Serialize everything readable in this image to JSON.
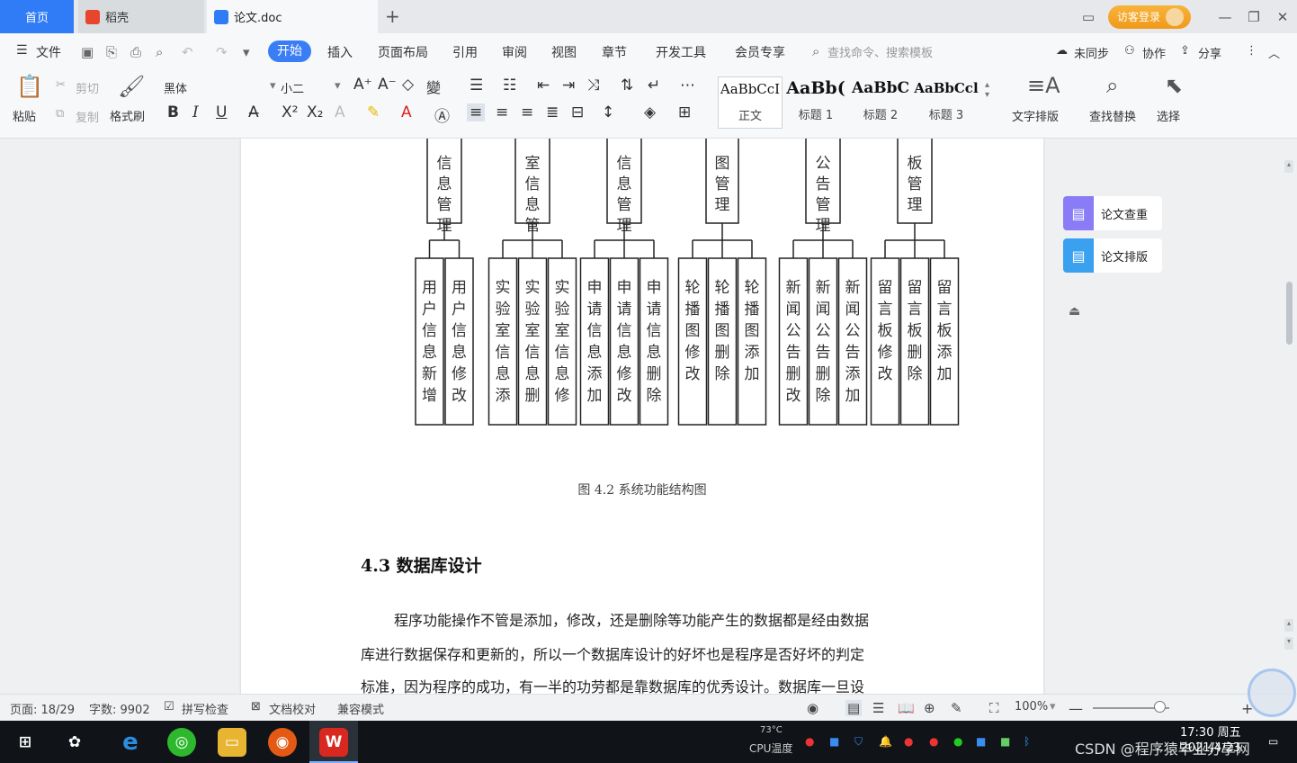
{
  "titlebar": {
    "tab_home": "首页",
    "tab_wps": "稻壳",
    "tab_doc": "论文.doc",
    "login": "访客登录"
  },
  "menu": {
    "file": "文件",
    "items": [
      "开始",
      "插入",
      "页面布局",
      "引用",
      "审阅",
      "视图",
      "章节",
      "开发工具",
      "会员专享"
    ],
    "search": "查找命令、搜索模板",
    "sync": "未同步",
    "collab": "协作",
    "share": "分享"
  },
  "ribbon": {
    "paste": "粘贴",
    "cut": "剪切",
    "copy": "复制",
    "format_painter": "格式刷",
    "font_name": "黑体",
    "font_size": "小二",
    "styles": [
      {
        "sample": "AaBbCcI",
        "name": "正文"
      },
      {
        "sample": "AaBb(",
        "name": "标题 1"
      },
      {
        "sample": "AaBbC",
        "name": "标题 2"
      },
      {
        "sample": "AaBbCcl",
        "name": "标题 3"
      }
    ],
    "text_layout": "文字排版",
    "find_replace": "查找替换",
    "select": "选择"
  },
  "diagram": {
    "top_boxes": [
      "信息管理",
      "室信息管",
      "信息管理",
      "图管理",
      "公告管理",
      "板管理"
    ],
    "leaves": [
      [
        "用户信息新增",
        "用户信息修改"
      ],
      [
        "实验室信息添",
        "实验室信息删",
        "实验室信息修"
      ],
      [
        "申请信息添加",
        "申请信息修改",
        "申请信息删除"
      ],
      [
        "轮播图修改",
        "轮播图删除",
        "轮播图添加"
      ],
      [
        "新闻公告删改",
        "新闻公告删除",
        "新闻公告添加"
      ],
      [
        "留言板修改",
        "留言板删除",
        "留言板添加"
      ]
    ]
  },
  "document": {
    "caption": "图 4.2  系统功能结构图",
    "section_title": "4.3  数据库设计",
    "paragraph_lines": [
      "程序功能操作不管是添加，修改，还是删除等功能产生的数据都是经由数据",
      "库进行数据保存和更新的，所以一个数据库设计的好坏也是程序是否好坏的判定",
      "标准，因为程序的成功，有一半的功劳都是靠数据库的优秀设计。数据库一旦设"
    ]
  },
  "sidepanel": {
    "check": "论文查重",
    "layout": "论文排版"
  },
  "status": {
    "page": "页面: 18/29",
    "words": "字数: 9902",
    "spell": "拼写检查",
    "proof": "文档校对",
    "compat": "兼容模式",
    "zoom": "100%"
  },
  "taskbar": {
    "temp": "73°C",
    "cpu": "CPU温度",
    "time": "17:30 周五",
    "date": "2021/4/23",
    "watermark": "CSDN @程序猿毕业分享网"
  },
  "colors": {
    "accent": "#3a7ef6",
    "login": "#f0a028",
    "check_icon": "#8a7cf6",
    "layout_icon": "#3aa0f0"
  }
}
